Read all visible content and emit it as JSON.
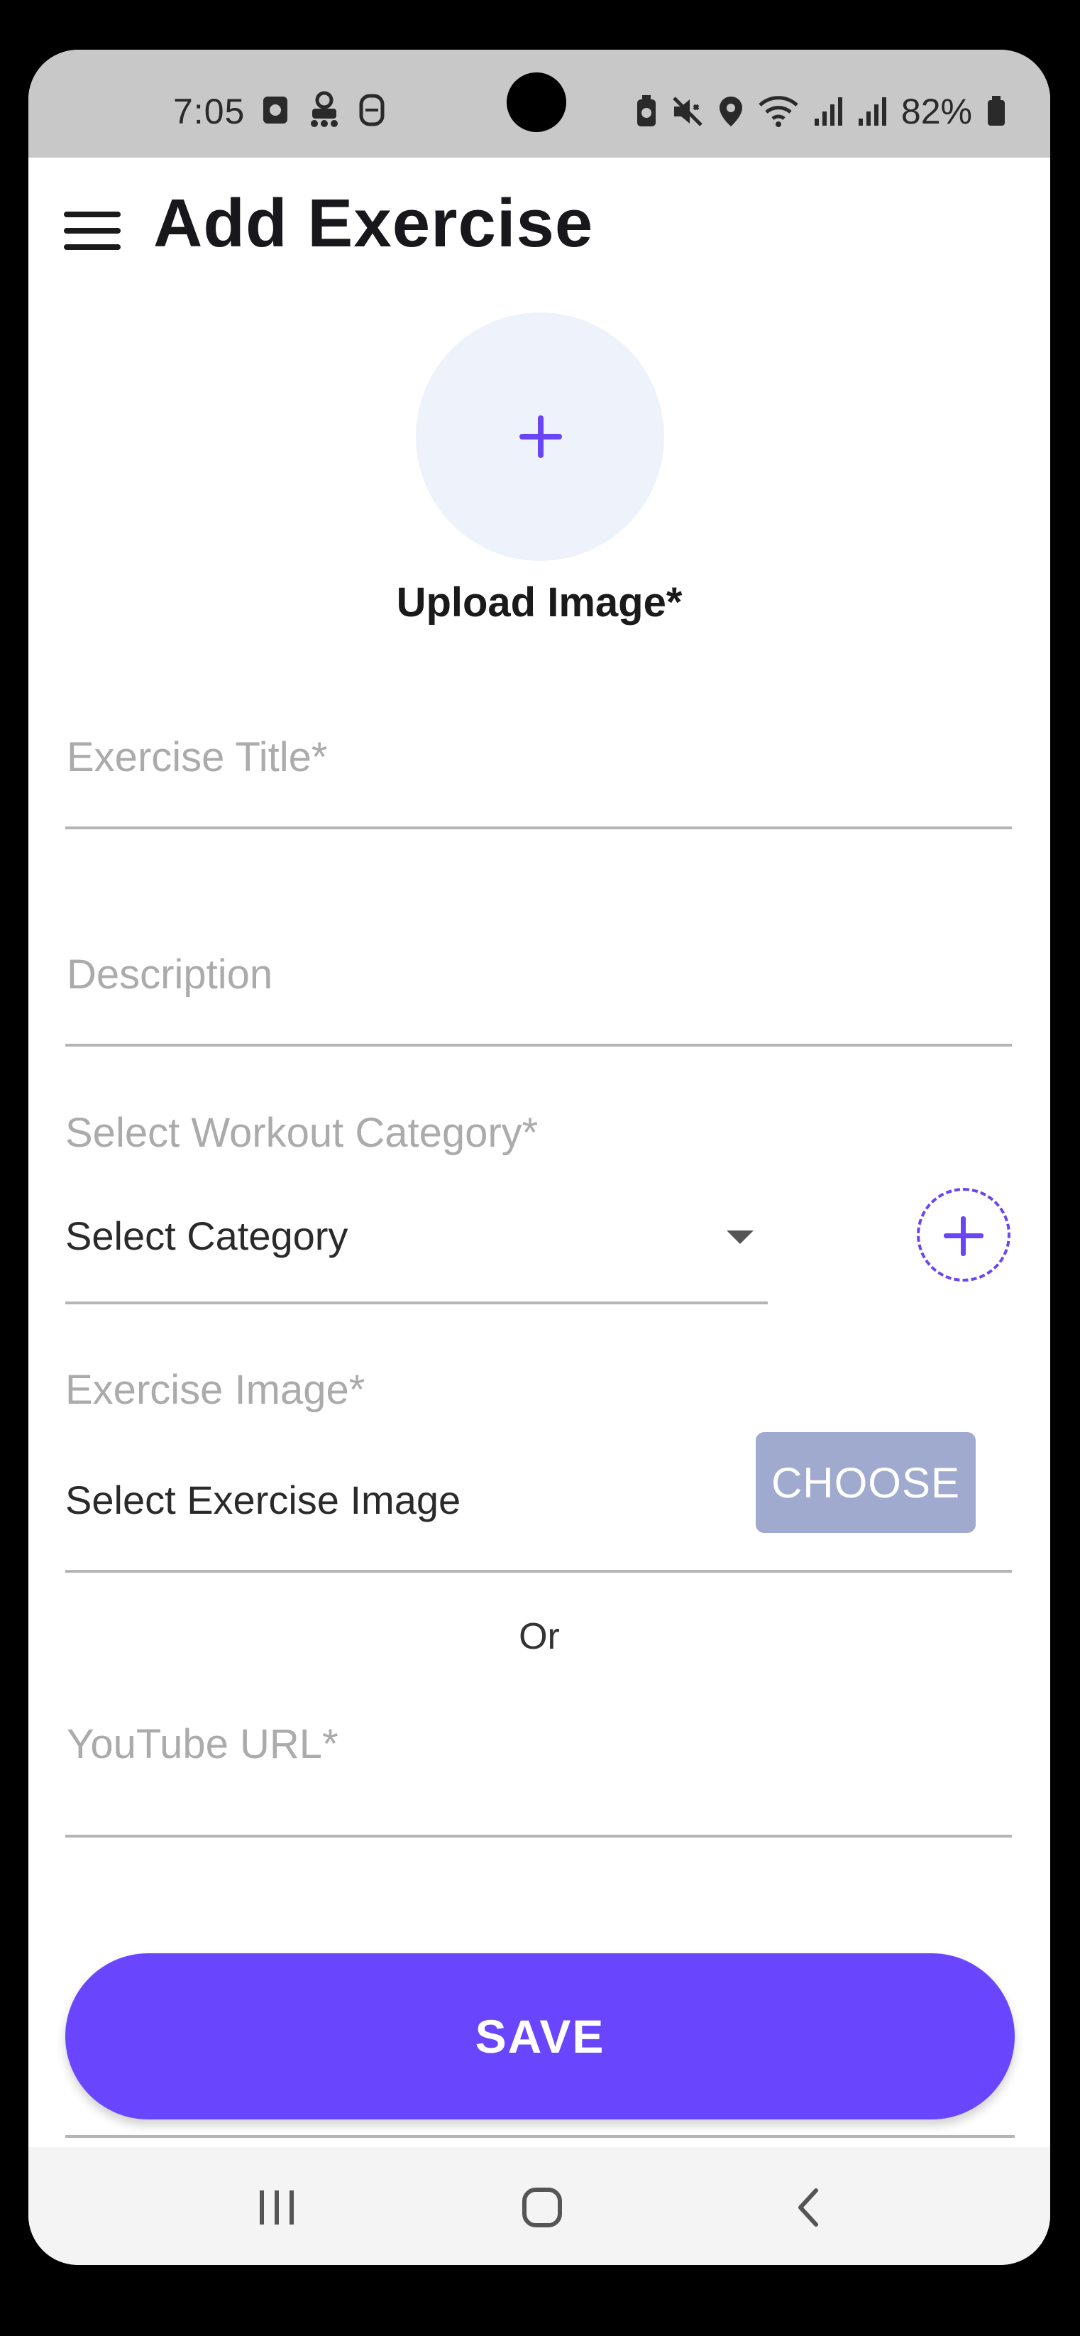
{
  "status_bar": {
    "time": "7:05",
    "battery": "82%",
    "left_icons": [
      "screen-record-icon",
      "game-controller-icon",
      "s-app-icon"
    ],
    "right_icons": [
      "battery-saver-icon",
      "mute-icon",
      "location-icon",
      "wifi-icon",
      "signal-icon",
      "signal-icon",
      "battery-icon"
    ]
  },
  "header": {
    "title": "Add Exercise",
    "menu_icon": "hamburger-menu-icon"
  },
  "upload": {
    "label": "Upload Image*",
    "icon": "plus-icon"
  },
  "form": {
    "title_placeholder": "Exercise Title*",
    "description_placeholder": "Description",
    "category": {
      "label": "Select Workout Category*",
      "selected": "Select Category",
      "add_icon": "plus-icon"
    },
    "exercise_image": {
      "label": "Exercise Image*",
      "value": "Select Exercise Image",
      "button": "CHOOSE"
    },
    "or_text": "Or",
    "youtube_placeholder": "YouTube URL*",
    "save_button": "SAVE"
  },
  "nav_bar": {
    "items": [
      "recent-apps-icon",
      "home-icon",
      "back-icon"
    ]
  },
  "colors": {
    "accent": "#6a45fe",
    "choose_button": "#a0aace",
    "upload_circle": "#eef2fb",
    "status_bar": "#c8c8c8"
  }
}
